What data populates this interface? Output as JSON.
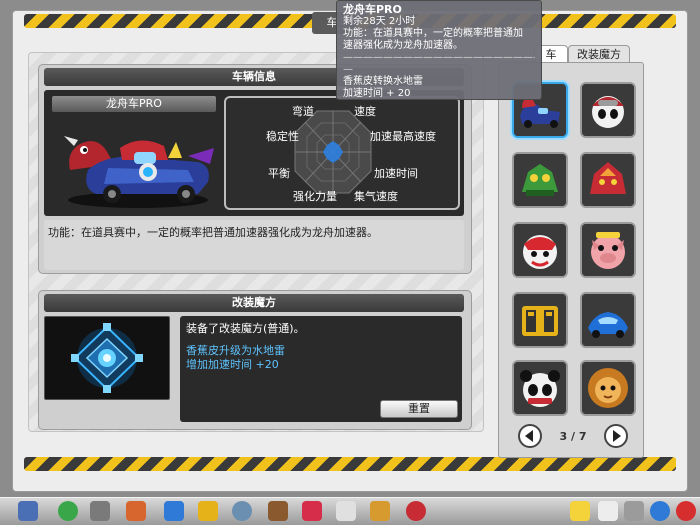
{
  "window": {
    "title": "车"
  },
  "vehicle": {
    "section_title": "车辆信息",
    "name": "龙舟车PRO",
    "stats": [
      "弯道",
      "速度",
      "稳定性",
      "加速最高速度",
      "平衡",
      "加速时间",
      "强化力量",
      "集气速度"
    ],
    "description": "功能：在道具赛中，一定的概率把普通加速器强化成为龙舟加速器。"
  },
  "mod": {
    "section_title": "改装魔方",
    "equipped_text": "装备了改装魔方(普通)。",
    "effect_line1": "香蕉皮升级为水地雷",
    "effect_line2": "增加加速时间 +20",
    "reset_label": "重置"
  },
  "tabs": {
    "vehicle_label": "车",
    "mod_label": "改装魔方"
  },
  "pager": {
    "text": "3 / 7",
    "prev_icon": "arrow-left-icon",
    "next_icon": "arrow-right-icon"
  },
  "tooltip": {
    "title": "龙舟车PRO",
    "remaining": "剩余28天 2小时",
    "function_line1": "功能：在道具赛中，一定的概率把普通加",
    "function_line2": "速器强化成为龙舟加速器。",
    "separator1": "———————————————————————",
    "separator2": "—",
    "upgrade_line1": "香蕉皮转换水地雷",
    "upgrade_line2": "加速时间 + 20"
  },
  "colors": {
    "accent_blue": "#39a8e8",
    "effect_text": "#5ec4ff",
    "hazard_yellow": "#f1c21b"
  },
  "car_slots": [
    {
      "icon": "dragon-boat-car-icon",
      "selected": true
    },
    {
      "icon": "panda-helmet-car-icon",
      "selected": false
    },
    {
      "icon": "green-dragon-car-icon",
      "selected": false
    },
    {
      "icon": "red-dragon-car-icon",
      "selected": false
    },
    {
      "icon": "lion-dance-car-icon",
      "selected": false
    },
    {
      "icon": "pig-car-icon",
      "selected": false
    },
    {
      "icon": "yellow-mech-car-icon",
      "selected": false
    },
    {
      "icon": "blue-sports-car-icon",
      "selected": false
    },
    {
      "icon": "panda-car-icon",
      "selected": false
    },
    {
      "icon": "lion-car-icon",
      "selected": false
    }
  ],
  "taskbar_icons": [
    "system-logo-icon",
    "back-icon",
    "shop-cart-icon",
    "character-icon",
    "kart-icon",
    "item-icon",
    "gear-icon",
    "tools-icon",
    "heart-icon",
    "message-icon",
    "flag-icon",
    "book-icon",
    "mail-icon",
    "memo-icon",
    "settings-icon",
    "search-icon",
    "power-icon"
  ]
}
